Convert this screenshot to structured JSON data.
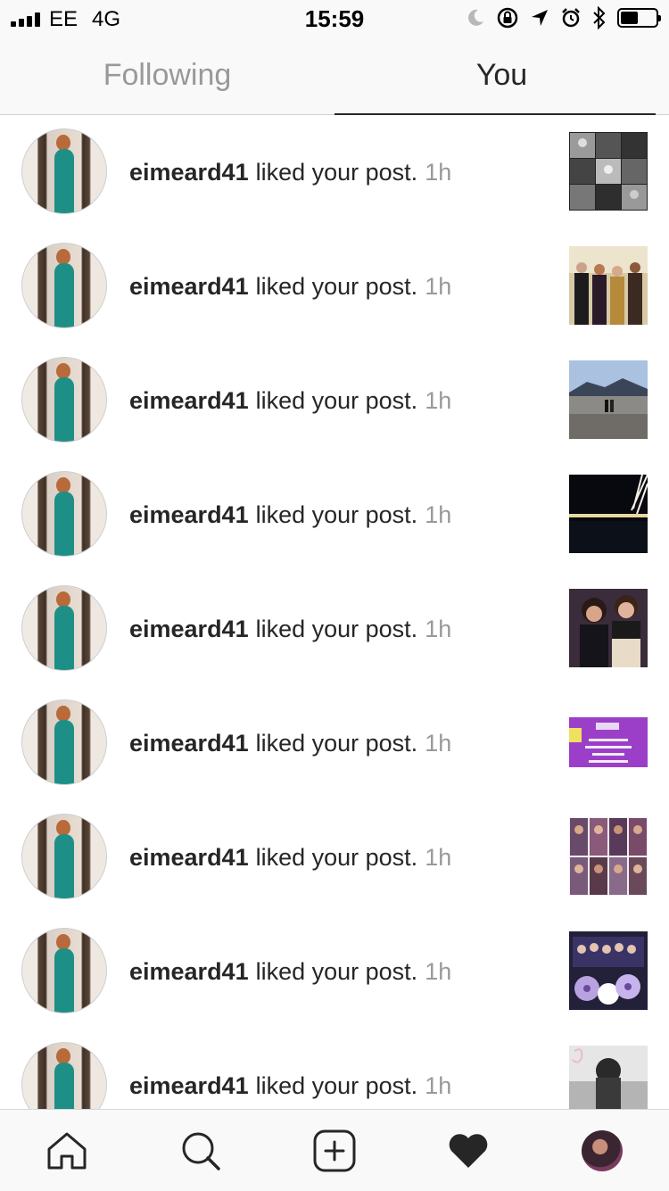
{
  "status_bar": {
    "carrier": "EE",
    "network": "4G",
    "time": "15:59",
    "battery_level": 0.45,
    "icons": [
      "signal-icon",
      "moon-icon",
      "rotation-lock-icon",
      "location-arrow-icon",
      "alarm-icon",
      "bluetooth-icon",
      "battery-icon"
    ]
  },
  "tabs": [
    {
      "label": "Following",
      "active": false
    },
    {
      "label": "You",
      "active": true
    }
  ],
  "notifications": [
    {
      "username": "eimeard41",
      "action": "liked your post.",
      "time": "1h",
      "thumbnail": "bw-photo-grid"
    },
    {
      "username": "eimeard41",
      "action": "liked your post.",
      "time": "1h",
      "thumbnail": "group-of-four-people"
    },
    {
      "username": "eimeard41",
      "action": "liked your post.",
      "time": "1h",
      "thumbnail": "beach-landscape"
    },
    {
      "username": "eimeard41",
      "action": "liked your post.",
      "time": "1h",
      "thumbnail": "night-city-lights"
    },
    {
      "username": "eimeard41",
      "action": "liked your post.",
      "time": "1h",
      "thumbnail": "two-friends-selfie"
    },
    {
      "username": "eimeard41",
      "action": "liked your post.",
      "time": "1h",
      "thumbnail": "purple-poster"
    },
    {
      "username": "eimeard41",
      "action": "liked your post.",
      "time": "1h",
      "thumbnail": "photo-booth-grid"
    },
    {
      "username": "eimeard41",
      "action": "liked your post.",
      "time": "1h",
      "thumbnail": "group-with-flowers"
    },
    {
      "username": "eimeard41",
      "action": "liked your post.",
      "time": "1h",
      "thumbnail": "bw-dancing-photo"
    }
  ],
  "bottom_nav": [
    {
      "name": "home",
      "icon": "home-icon"
    },
    {
      "name": "search",
      "icon": "search-icon"
    },
    {
      "name": "new-post",
      "icon": "plus-square-icon"
    },
    {
      "name": "activity",
      "icon": "heart-icon",
      "active": true
    },
    {
      "name": "profile",
      "icon": "profile-avatar"
    }
  ],
  "colors": {
    "primary_text": "#262626",
    "secondary_text": "#999999",
    "bar_background": "#f9f9f9",
    "divider": "#cfcfcf"
  }
}
